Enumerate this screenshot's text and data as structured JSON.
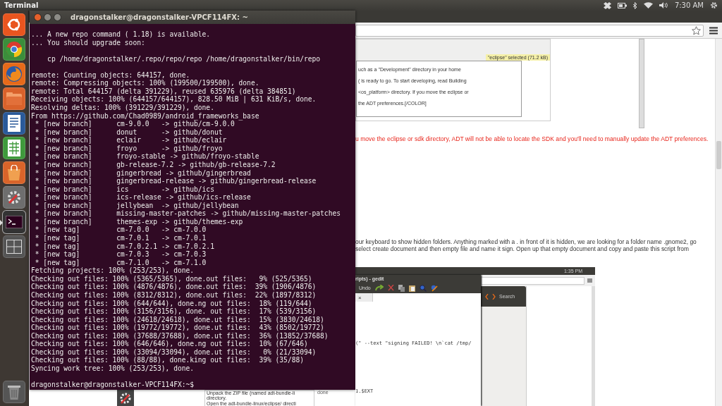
{
  "top_bar": {
    "app_title": "Terminal",
    "clock": "7:30 AM"
  },
  "launcher": {
    "items": [
      {
        "kind": "dash",
        "selected": false
      },
      {
        "kind": "chrome",
        "selected": false
      },
      {
        "kind": "firefox",
        "selected": false
      },
      {
        "kind": "files",
        "selected": false
      },
      {
        "kind": "writer",
        "selected": false
      },
      {
        "kind": "calc",
        "selected": false
      },
      {
        "kind": "store",
        "selected": false
      },
      {
        "kind": "settings",
        "selected": false
      },
      {
        "kind": "terminal",
        "selected": true
      },
      {
        "kind": "workspaces",
        "selected": false
      }
    ]
  },
  "terminal": {
    "title": "dragonstalker@dragonstalker-VPCF114FX: ~",
    "blocks": [
      [
        "... A new repo command ( 1.18) is available.",
        "... You should upgrade soon:"
      ],
      [
        "    cp /home/dragonstalker/.repo/repo/repo /home/dragonstalker/bin/repo"
      ],
      [
        "remote: Counting objects: 644157, done.",
        "remote: Compressing objects: 100% (199500/199500), done.",
        "remote: Total 644157 (delta 391229), reused 635976 (delta 384851)",
        "Receiving objects: 100% (644157/644157), 828.50 MiB | 631 KiB/s, done.",
        "Resolving deltas: 100% (391229/391229), done.",
        "From https://github.com/Chad0989/android_frameworks_base",
        " * [new branch]      cm-9.0.0   -> github/cm-9.0.0",
        " * [new branch]      donut      -> github/donut",
        " * [new branch]      eclair     -> github/eclair",
        " * [new branch]      froyo      -> github/froyo",
        " * [new branch]      froyo-stable -> github/froyo-stable",
        " * [new branch]      gb-release-7.2 -> github/gb-release-7.2",
        " * [new branch]      gingerbread -> github/gingerbread",
        " * [new branch]      gingerbread-release -> github/gingerbread-release",
        " * [new branch]      ics        -> github/ics",
        " * [new branch]      ics-release -> github/ics-release",
        " * [new branch]      jellybean  -> github/jellybean",
        " * [new branch]      missing-master-patches -> github/missing-master-patches",
        " * [new branch]      themes-exp -> github/themes-exp",
        " * [new tag]         cm-7.0.0   -> cm-7.0.0",
        " * [new tag]         cm-7.0.1   -> cm-7.0.1",
        " * [new tag]         cm-7.0.2.1 -> cm-7.0.2.1",
        " * [new tag]         cm-7.0.3   -> cm-7.0.3",
        " * [new tag]         cm-7.1.0   -> cm-7.1.0",
        "Fetching projects: 100% (253/253), done.",
        "Checking out files: 100% (5365/5365), done.out files:   9% (525/5365)",
        "Checking out files: 100% (4876/4876), done.out files:  39% (1906/4876)",
        "Checking out files: 100% (8312/8312), done.out files:  22% (1897/8312)",
        "Checking out files: 100% (644/644), done.ng out files:  18% (119/644)",
        "Checking out files: 100% (3156/3156), done. out files:  17% (539/3156)",
        "Checking out files: 100% (24618/24618), done.ut files:  15% (3830/24618)",
        "Checking out files: 100% (19772/19772), done.ut files:  43% (8502/19772)",
        "Checking out files: 100% (37688/37688), done.ut files:  36% (13852/37688)",
        "Checking out files: 100% (646/646), done.ng out files:  10% (67/646)",
        "Checking out files: 100% (33094/33094), done.ut files:   0% (21/33094)",
        "Checking out files: 100% (88/88), done.king out files:  39% (35/88)",
        "Syncing work tree: 100% (253/253), done."
      ],
      [
        "dragonstalker@dragonstalker-VPCF114FX:~$"
      ]
    ]
  },
  "browser": {
    "file_dialog": {
      "tooltip": "\"eclipse\" selected (71.2 kB)",
      "lines": [
        "uch as a \"Development\" directory in your home",
        "( is ready to go. To start developing, read Building",
        "<os_platform> directory. If you move the eclipse or",
        "the ADT preferences.[/COLOR]"
      ]
    },
    "warning": "u move the eclipse or sdk directory, ADT will not be able to locate the SDK and you'll need to manually update the ADT preferences.",
    "paragraph": "our keyboard to show hidden folders. Anything marked with a . in front of it is hidden, we are looking for a folder name .gnome2, go select create document and then empty file and name it sign. Open up that empty document and copy and paste this script from",
    "screenshot": {
      "clock": "1:35 PM",
      "gedit_title": "ripts) - gedit",
      "undo": "Undo",
      "tab_close": "×",
      "code_lines": [
        "(\" --text \"signing FAILED! \\n`cat /tmp/",
        "1.$EXT"
      ],
      "search": "Search"
    },
    "bottom_text": {
      "lines": [
        "Unpack the ZIP file (named adt-bundle-li",
        "directory.",
        "Open the adt-bundle-linux/eclipse/ directi"
      ],
      "side": "done"
    }
  }
}
